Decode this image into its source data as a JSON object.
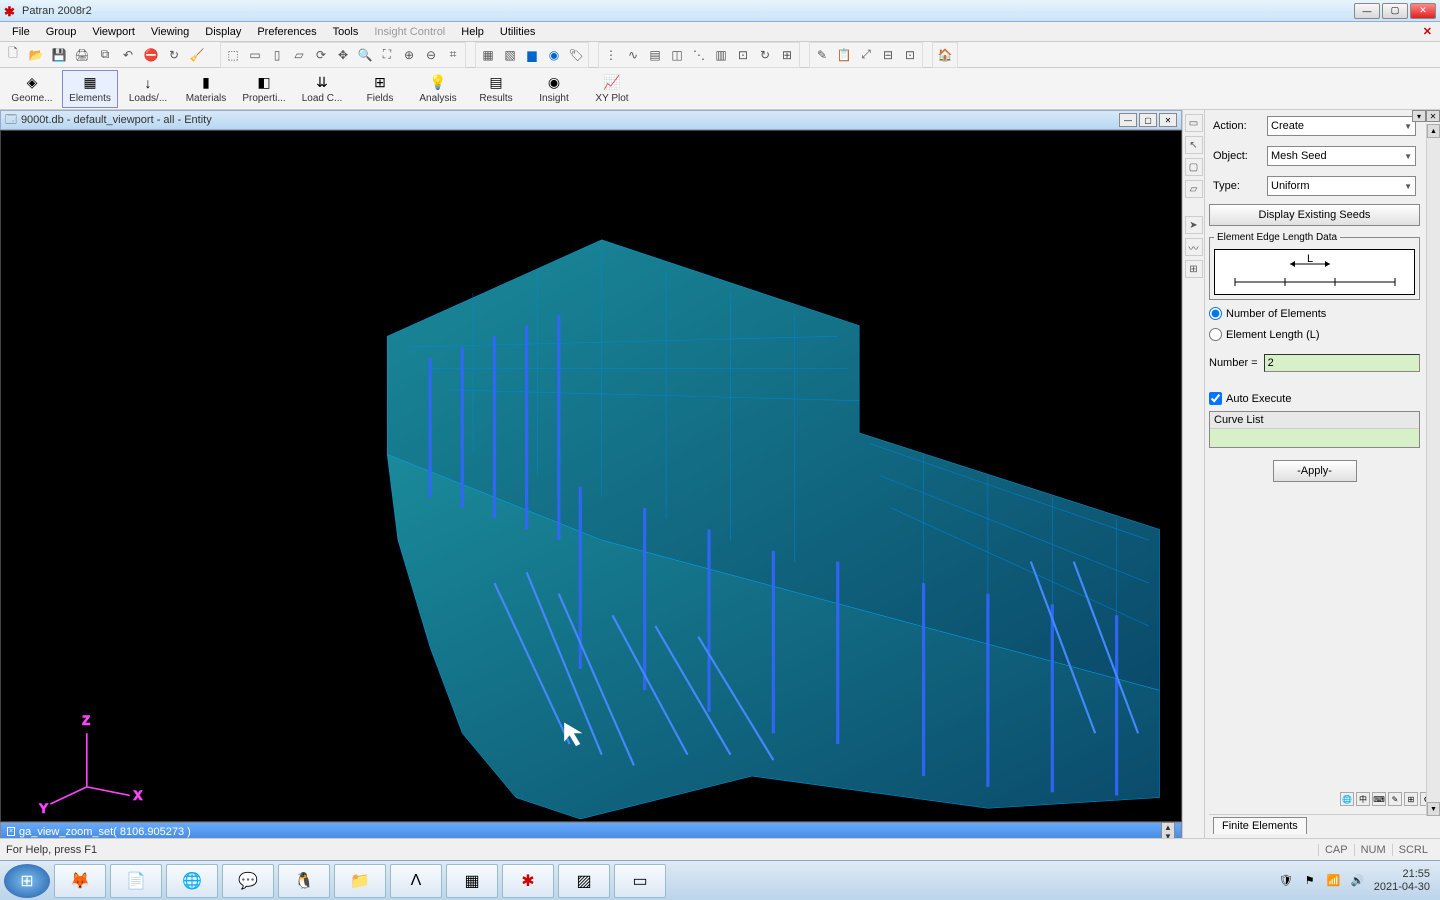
{
  "app_title": "Patran 2008r2",
  "menus": [
    "File",
    "Group",
    "Viewport",
    "Viewing",
    "Display",
    "Preferences",
    "Tools",
    "Insight Control",
    "Help",
    "Utilities"
  ],
  "menu_disabled_idx": 7,
  "app_toolbar": [
    {
      "label": "Geome...",
      "icon": "◈"
    },
    {
      "label": "Elements",
      "icon": "▦"
    },
    {
      "label": "Loads/...",
      "icon": "↓"
    },
    {
      "label": "Materials",
      "icon": "▮"
    },
    {
      "label": "Properti...",
      "icon": "◧"
    },
    {
      "label": "Load C...",
      "icon": "⇊"
    },
    {
      "label": "Fields",
      "icon": "⊞"
    },
    {
      "label": "Analysis",
      "icon": "💡"
    },
    {
      "label": "Results",
      "icon": "▤"
    },
    {
      "label": "Insight",
      "icon": "◉"
    },
    {
      "label": "XY Plot",
      "icon": "📈"
    }
  ],
  "viewport_title": "9000t.db - default_viewport - all - Entity",
  "history_cmd": "ga_view_zoom_set( 8106.905273 )",
  "axes": {
    "x": "X",
    "y": "Y",
    "z": "Z"
  },
  "panel": {
    "action_label": "Action:",
    "action_value": "Create",
    "object_label": "Object:",
    "object_value": "Mesh Seed",
    "type_label": "Type:",
    "type_value": "Uniform",
    "display_btn": "Display Existing Seeds",
    "edge_legend": "Element Edge Length Data",
    "diagram_L": "L",
    "radio_num": "Number of Elements",
    "radio_len": "Element Length (L)",
    "number_label": "Number =",
    "number_value": "2",
    "auto_exec": "Auto Execute",
    "curve_list": "Curve List",
    "apply": "-Apply-",
    "tab": "Finite Elements"
  },
  "status_msg": "For Help, press F1",
  "status_inds": [
    "CAP",
    "NUM",
    "SCRL"
  ],
  "clock_time": "21:55",
  "clock_date": "2021-04-30"
}
